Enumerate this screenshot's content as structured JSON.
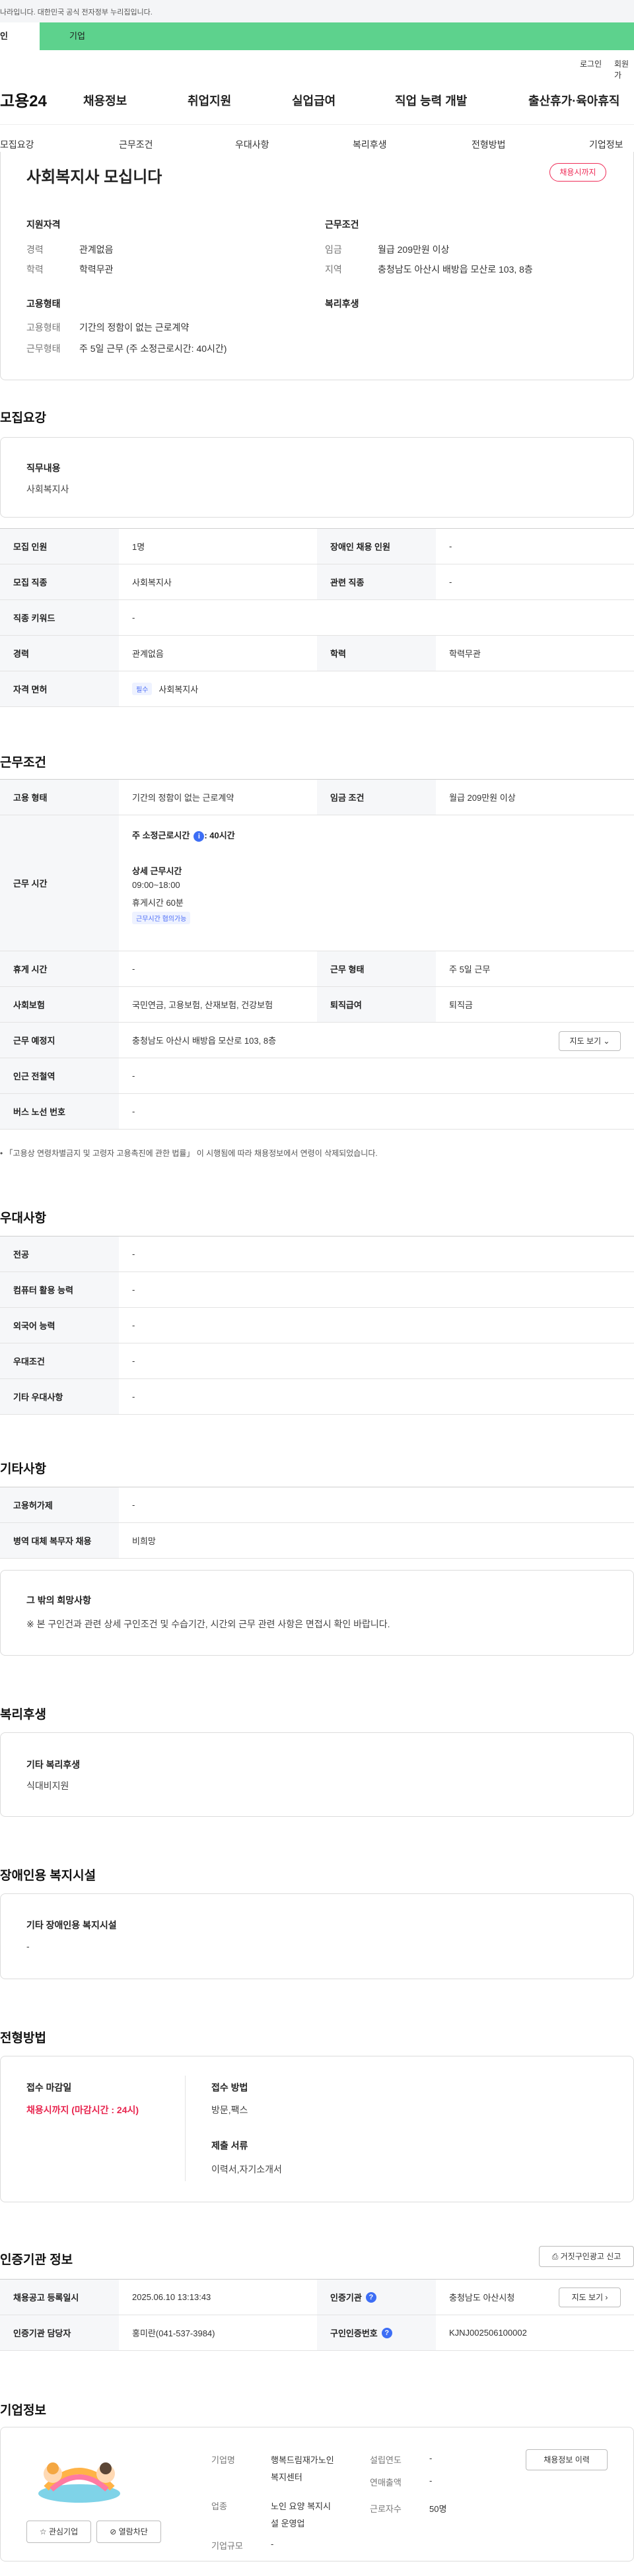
{
  "gov_banner": "나라입니다. 대한민국 공식 전자정부 누리집입니다.",
  "tabs": {
    "person": "인",
    "company": "기업"
  },
  "util": {
    "login": "로그인",
    "join": "회원가"
  },
  "logo": "고용24",
  "gnb": [
    "채용정보",
    "취업지원",
    "실업급여",
    "직업 능력 개발",
    "출산휴가·육아휴직"
  ],
  "sub_nav": [
    "모집요강",
    "근무조건",
    "우대사항",
    "복리후생",
    "전형방법",
    "기업정보"
  ],
  "summary": {
    "title": "사회복지사 모십니다",
    "status": "채용시까지",
    "qual_label": "지원자격",
    "career_key": "경력",
    "career_val": "관계없음",
    "edu_key": "학력",
    "edu_val": "학력무관",
    "cond_label": "근무조건",
    "wage_key": "임금",
    "wage_val": "월급 209만원 이상",
    "area_key": "지역",
    "area_val": "충청남도 아산시 배방읍 모산로 103, 8층",
    "emp_label": "고용형태",
    "emp_key": "고용형태",
    "emp_val": "기간의 정함이 없는 근로계약",
    "form_key": "근무형태",
    "form_val": "주 5일 근무 (주 소정근로시간: 40시간)",
    "welfare_label": "복리후생"
  },
  "recruit": {
    "heading": "모집요강",
    "duty_title": "직무내용",
    "duty_text": "사회복지사",
    "rows": {
      "count_k": "모집 인원",
      "count_v": "1명",
      "disabled_k": "장애인 채용 인원",
      "disabled_v": "-",
      "job_k": "모집 직종",
      "job_v": "사회복지사",
      "related_k": "관련 직종",
      "related_v": "-",
      "keyword_k": "직종 키워드",
      "keyword_v": "-",
      "career_k": "경력",
      "career_v": "관계없음",
      "edu_k": "학력",
      "edu_v": "학력무관",
      "license_k": "자격 면허",
      "license_badge": "필수",
      "license_v": "사회복지사"
    }
  },
  "work": {
    "heading": "근무조건",
    "emp_k": "고용 형태",
    "emp_v": "기간의 정함이 없는 근로계약",
    "wage_k": "임금 조건",
    "wage_v": "월급 209만원 이상",
    "hours_k": "근무 시간",
    "hours_main": "주 소정근로시간",
    "hours_main_val": ": 40시간",
    "hours_detail_title": "상세 근무시간",
    "hours_time": "09:00~18:00",
    "hours_break": "휴게시간 60분",
    "hours_badge": "근무시간 협의가능",
    "holiday_k": "휴게 시간",
    "holiday_v": "-",
    "form_k": "근무 형태",
    "form_v": "주 5일 근무",
    "insurance_k": "사회보험",
    "insurance_v": "국민연금, 고용보험, 산재보험, 건강보험",
    "retire_k": "퇴직급여",
    "retire_v": "퇴직금",
    "place_k": "근무 예정지",
    "place_v": "충청남도 아산시 배방읍 모산로 103, 8층",
    "map_btn": "지도 보기",
    "subway_k": "인근 전철역",
    "subway_v": "-",
    "bus_k": "버스 노선 번호",
    "bus_v": "-",
    "note": "「고용상 연령차별금지 및 고령자 고용촉진에 관한 법률」 이 시행됨에 따라 채용정보에서 연령이 삭제되었습니다."
  },
  "pref": {
    "heading": "우대사항",
    "major_k": "전공",
    "major_v": "-",
    "computer_k": "컴퓨터 활용 능력",
    "computer_v": "-",
    "lang_k": "외국어 능력",
    "lang_v": "-",
    "cond_k": "우대조건",
    "cond_v": "-",
    "etc_k": "기타 우대사항",
    "etc_v": "-"
  },
  "etc": {
    "heading": "기타사항",
    "support_k": "고용허가제",
    "support_v": "-",
    "military_k": "병역 대체 복무자 채용",
    "military_v": "비희망",
    "wish_title": "그 밖의 희망사항",
    "wish_text": "※ 본 구인건과 관련 상세 구인조건 및 수습기간, 시간외 근무 관련 사항은 면접시 확인 바랍니다."
  },
  "welfare": {
    "heading": "복리후생",
    "title": "기타 복리후생",
    "text": "식대비지원"
  },
  "disabled_fac": {
    "heading": "장애인용 복지시설",
    "title": "기타 장애인용 복지시설",
    "text": "-"
  },
  "selection": {
    "heading": "전형방법",
    "deadline_title": "접수 마감일",
    "deadline_text": "채용시까지 (마감시간 : 24시)",
    "method_title": "접수 방법",
    "method_text": "방문,팩스",
    "docs_title": "제출 서류",
    "docs_text": "이력서,자기소개서"
  },
  "cert": {
    "heading": "인증기관 정보",
    "report_btn": "거짓구인광고 신고",
    "date_k": "채용공고 등록일시",
    "date_v": "2025.06.10 13:13:43",
    "org_k": "인증기관",
    "org_v": "충청남도 아산시청",
    "manager_k": "인증기관 담당자",
    "manager_v": "홍미란(041-537-3984)",
    "num_k": "구인인증번호",
    "num_v": "KJNJ002506100002",
    "map_btn": "지도 보기"
  },
  "company": {
    "heading": "기업정보",
    "fav_btn": "관심기업",
    "block_btn": "열람차단",
    "name_k": "기업명",
    "name_v1": "행복드림재가노인",
    "name_v2": "복지센터",
    "year_k": "설립연도",
    "year_v": "-",
    "sales_k": "연매출액",
    "sales_v": "-",
    "type_k": "업종",
    "type_v1": "노인 요양 복지시",
    "type_v2": "설 운영업",
    "emp_k": "근로자수",
    "emp_v": "50명",
    "size_k": "기업규모",
    "size_v": "-",
    "history_btn": "채용정보 이력"
  }
}
